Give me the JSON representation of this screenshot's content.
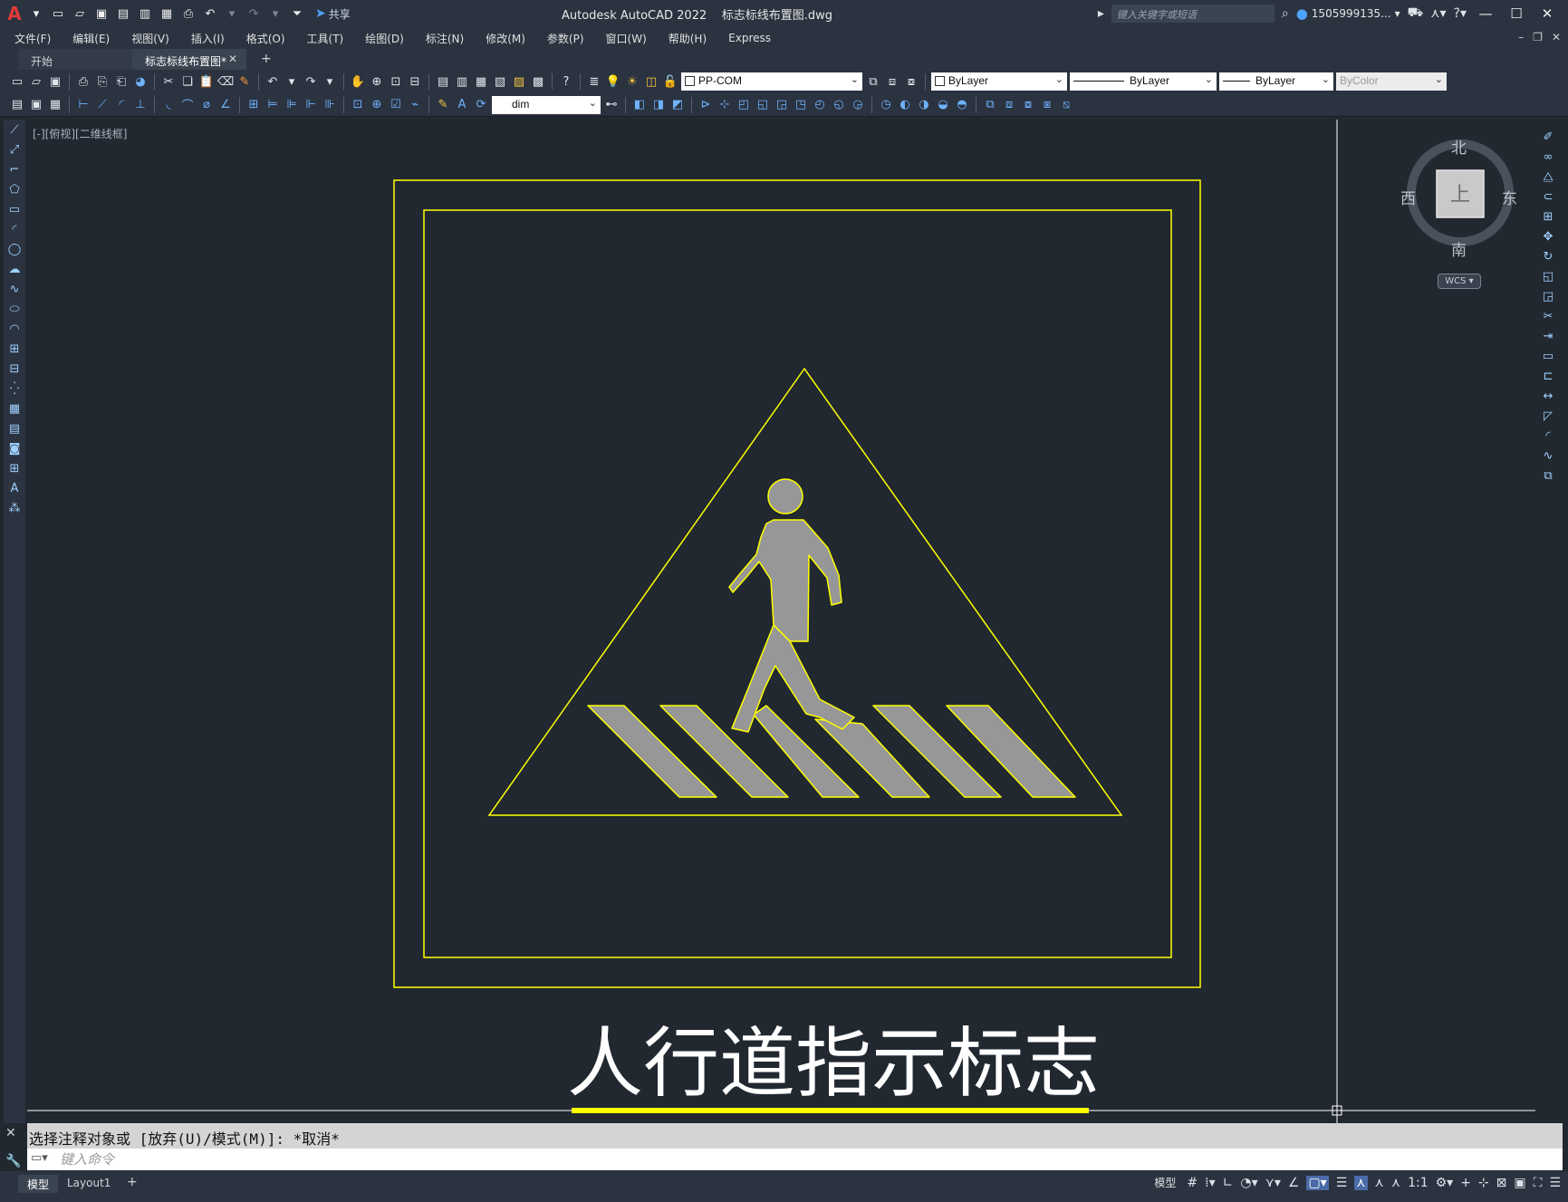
{
  "titlebar": {
    "app_title": "Autodesk AutoCAD 2022",
    "file_name": "标志标线布置图.dwg",
    "share_label": "共享",
    "search_placeholder": "键入关键字或短语",
    "user_name": "1505999135..."
  },
  "menubar": {
    "items": [
      "文件(F)",
      "编辑(E)",
      "视图(V)",
      "插入(I)",
      "格式(O)",
      "工具(T)",
      "绘图(D)",
      "标注(N)",
      "修改(M)",
      "参数(P)",
      "窗口(W)",
      "帮助(H)",
      "Express"
    ]
  },
  "tabs": {
    "start": "开始",
    "active": "标志标线布置图*"
  },
  "toolbar": {
    "layer": "PP-COM",
    "color": "ByLayer",
    "linetype": "ByLayer",
    "lineweight": "ByLayer",
    "plotstyle": "ByColor",
    "dimstyle": "dim"
  },
  "viewport": {
    "label": "[-][俯视][二维线框]"
  },
  "drawing": {
    "caption": "人行道指示标志",
    "line_color": "#ffff00",
    "fill_color": "#979797"
  },
  "viewcube": {
    "north": "北",
    "south": "南",
    "east": "东",
    "west": "西",
    "face": "上",
    "wcs": "WCS"
  },
  "command": {
    "history": "选择注释对象或 [放弃(U)/模式(M)]: *取消*",
    "placeholder": "键入命令"
  },
  "statusbar": {
    "layouts": [
      "模型",
      "Layout1"
    ],
    "model_label": "模型",
    "scale": "1:1"
  }
}
